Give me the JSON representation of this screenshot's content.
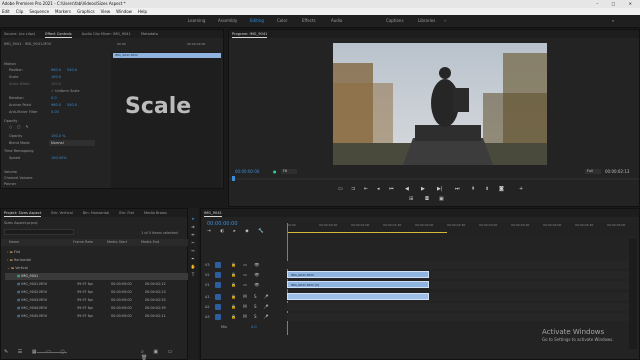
{
  "app": {
    "title": "Adobe Premiere Pro 2021 - C:\\Users\\fab\\Videos\\Sizes Aspect *",
    "window_controls": "–  □  ✕"
  },
  "menu": [
    "Edit",
    "Clip",
    "Sequence",
    "Markers",
    "Graphics",
    "View",
    "Window",
    "Help"
  ],
  "workspaces": [
    {
      "label": "Learning",
      "active": false
    },
    {
      "label": "Assembly",
      "active": false
    },
    {
      "label": "Editing",
      "active": true
    },
    {
      "label": "Color",
      "active": false
    },
    {
      "label": "Effects",
      "active": false
    },
    {
      "label": "Audio",
      "active": false
    },
    {
      "label": "Captions",
      "active": false
    },
    {
      "label": "Libraries",
      "active": false
    }
  ],
  "effect_controls": {
    "tabs": [
      "Source: (no clips)",
      "Effect Controls",
      "Audio Clip Mixer: IMG_9041",
      "Metadata"
    ],
    "header_clip": "IMG_9041 · IMG_9041.MOV",
    "timeline_start": "00:00",
    "timeline_end": "00:00:02:00",
    "clip_label": "IMG_9041.MOV",
    "section_motion": "Motion",
    "properties": [
      {
        "name": "Position",
        "value": "960.0",
        "value2": "540.0"
      },
      {
        "name": "Scale",
        "value": "100.0",
        "value2": ""
      },
      {
        "name": "Scale Width",
        "value": "100.0",
        "value2": ""
      },
      {
        "name": "",
        "value": "",
        "value2": "✓ Uniform Scale"
      },
      {
        "name": "Rotation",
        "value": "0.0",
        "value2": ""
      },
      {
        "name": "Anchor Point",
        "value": "960.0",
        "value2": "540.0"
      },
      {
        "name": "Anti-flicker Filter",
        "value": "0.00",
        "value2": ""
      }
    ],
    "section_opacity": "Opacity",
    "opacity": {
      "name": "Opacity",
      "value": "100.0 %"
    },
    "blend": {
      "name": "Blend Mode",
      "value": "Normal"
    },
    "section_time": "Time Remapping",
    "speed": {
      "name": "Speed",
      "value": "100.00%"
    },
    "section_volume": "Volume",
    "channel_volume": "Channel Volume",
    "panner": "Panner",
    "overlay_text": "Scale"
  },
  "program": {
    "tab": "Program: IMG_9041",
    "timecode_left": "00:00:00:00",
    "fit": "Fit",
    "quality": "Full",
    "timecode_right": "00:00:02:13"
  },
  "project": {
    "tabs": [
      "Project: Sizes Aspect",
      "Bin: Vertical",
      "Bin: Horizontal",
      "Bin: Flat",
      "Media Brows"
    ],
    "path": "Sizes Aspect.prproj",
    "selection_info": "1 of 5 items selected",
    "columns": [
      "Name",
      "Frame Rate",
      "Media Start",
      "Media End"
    ],
    "rows": [
      {
        "name": "Flat",
        "fps": "",
        "start": "",
        "end": "",
        "type": "bin",
        "indent": 1
      },
      {
        "name": "Horizontal",
        "fps": "",
        "start": "",
        "end": "",
        "type": "bin",
        "indent": 1
      },
      {
        "name": "Vertical",
        "fps": "",
        "start": "",
        "end": "",
        "type": "bin",
        "indent": 1
      },
      {
        "name": "IMG_9041",
        "fps": "",
        "start": "",
        "end": "",
        "type": "seq",
        "indent": 2
      },
      {
        "name": "IMG_9041.MOV",
        "fps": "59.97 fps",
        "start": "00:00:00:00",
        "end": "00:00:02:12",
        "type": "clip",
        "indent": 2
      },
      {
        "name": "IMG_9042.MOV",
        "fps": "59.97 fps",
        "start": "00:00:00:00",
        "end": "00:00:02:23",
        "type": "clip",
        "indent": 2
      },
      {
        "name": "IMG_9043.MOV",
        "fps": "59.97 fps",
        "start": "00:00:00:00",
        "end": "00:00:02:55",
        "type": "clip",
        "indent": 2
      },
      {
        "name": "IMG_9044.MOV",
        "fps": "59.97 fps",
        "start": "00:00:00:00",
        "end": "00:00:02:39",
        "type": "clip",
        "indent": 2
      },
      {
        "name": "IMG_9045.MOV",
        "fps": "59.97 fps",
        "start": "00:00:00:00",
        "end": "00:00:02:11",
        "type": "clip",
        "indent": 2
      }
    ]
  },
  "timeline": {
    "tab": "IMG_9041",
    "timecode": "00:00:00:00",
    "ruler": [
      "00:00",
      "00:00:00:30",
      "00:00:01:00",
      "00:00:01:30",
      "00:00:02:00",
      "00:00:02:30",
      "00:00:03:00",
      "00:00:03:30",
      "00:00:04:00",
      "00:00:04:30",
      "00:00:05:00"
    ],
    "tracks": [
      "V3",
      "V2",
      "V1",
      "A1",
      "A2",
      "A3"
    ],
    "mix_label": "Mix",
    "mix_value": "0.0",
    "clips": [
      {
        "label": "IMG_9041.MOV",
        "track": "V2"
      },
      {
        "label": "IMG_9041.MOV [V]",
        "track": "V1"
      },
      {
        "label": "",
        "track": "A1"
      }
    ]
  },
  "watermark": {
    "line1": "Activate Windows",
    "line2": "Go to Settings to activate Windows."
  }
}
